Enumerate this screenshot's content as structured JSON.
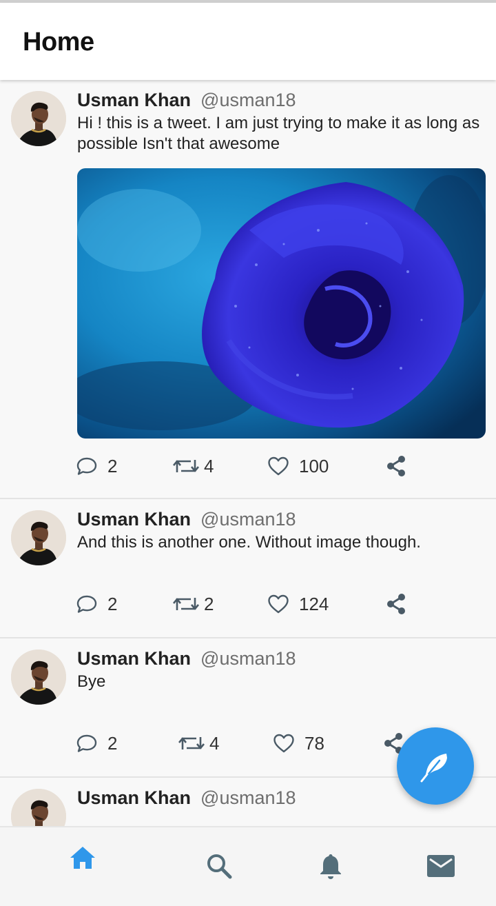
{
  "header": {
    "title": "Home"
  },
  "colors": {
    "accent": "#2f97ea",
    "nav_inactive": "#546e7a",
    "text": "#222222",
    "handle": "#6e6e6e"
  },
  "tweets": [
    {
      "name": "Usman Khan",
      "handle": "@usman18",
      "text": "Hi ! this is a tweet. I am just trying to make it as long as possible Isn't that awesome",
      "has_image": true,
      "image_desc": "blue-rose-photo",
      "comments": "2",
      "retweets": "4",
      "likes": "100"
    },
    {
      "name": "Usman Khan",
      "handle": "@usman18",
      "text": "And this is another one. Without image though.",
      "has_image": false,
      "comments": "2",
      "retweets": "2",
      "likes": "124"
    },
    {
      "name": "Usman Khan",
      "handle": "@usman18",
      "text": "Bye",
      "has_image": false,
      "comments": "2",
      "retweets": "4",
      "likes": "78"
    },
    {
      "name": "Usman Khan",
      "handle": "@usman18"
    }
  ],
  "fab": {
    "icon": "feather-icon"
  },
  "bottom_nav": [
    {
      "icon": "home-icon",
      "active": true
    },
    {
      "icon": "search-icon",
      "active": false
    },
    {
      "icon": "bell-icon",
      "active": false
    },
    {
      "icon": "mail-icon",
      "active": false
    }
  ]
}
